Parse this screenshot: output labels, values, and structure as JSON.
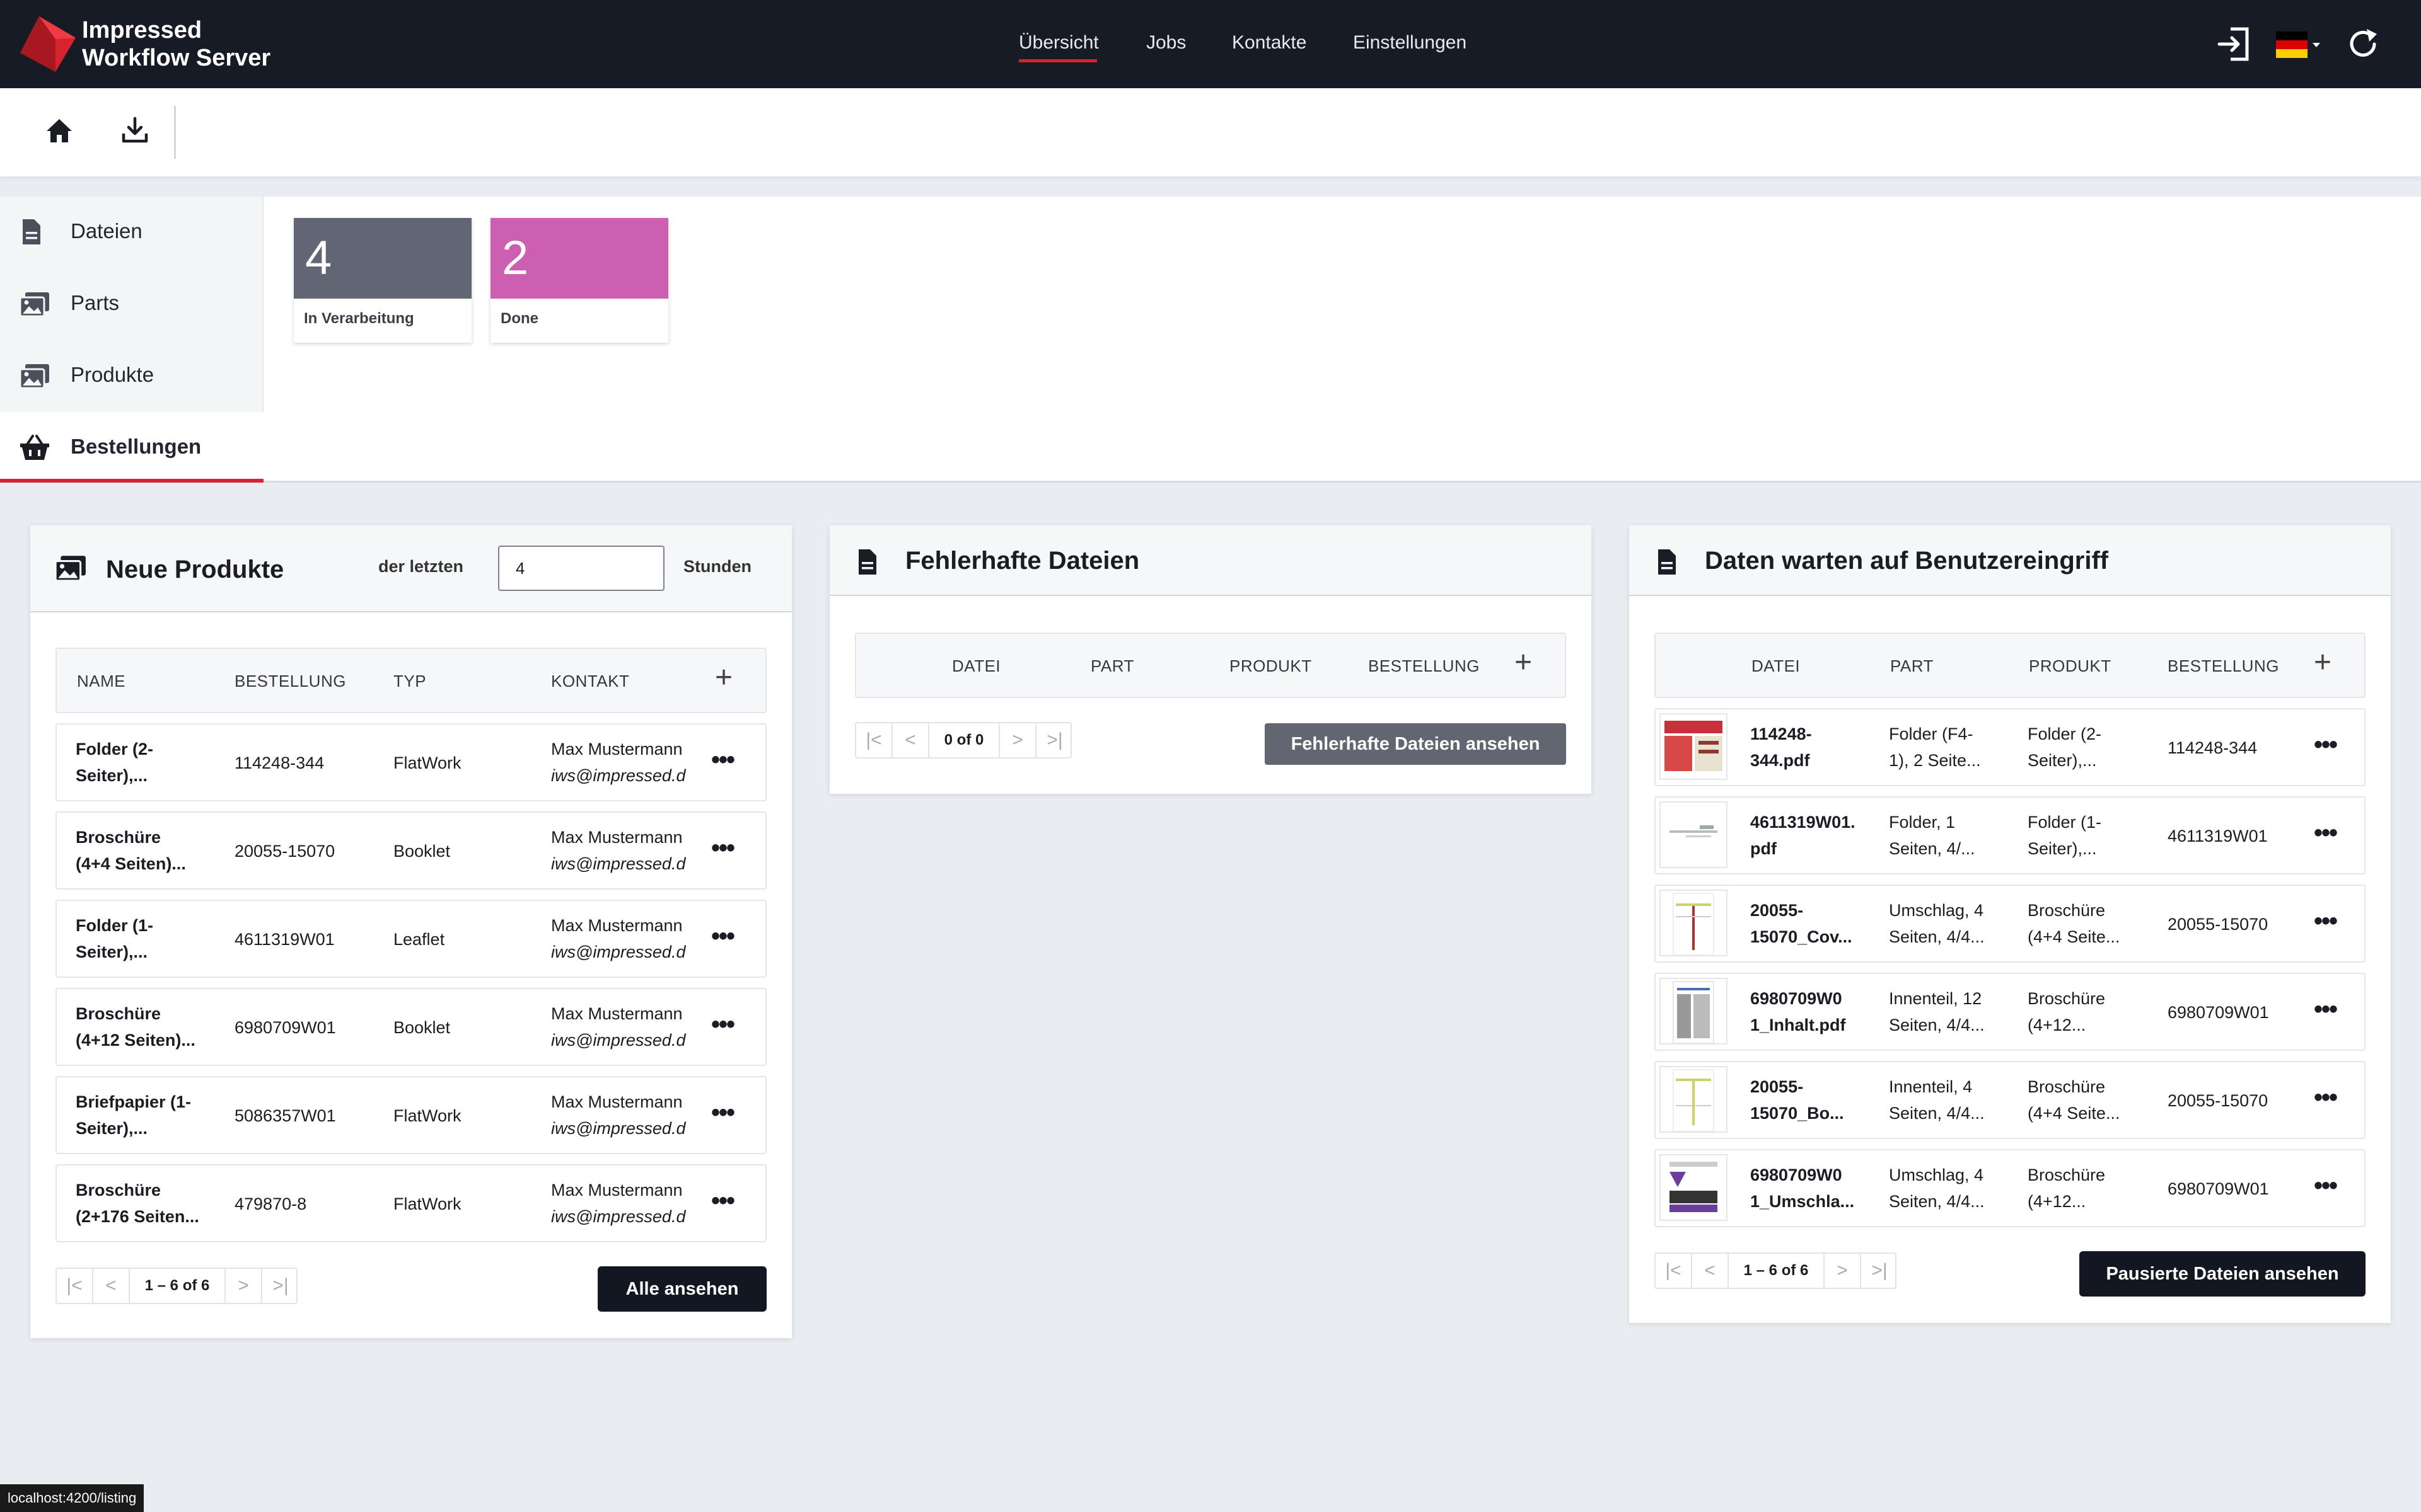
{
  "brand": {
    "line1": "Impressed",
    "line2": "Workflow Server"
  },
  "nav": [
    {
      "label": "Übersicht",
      "active": true
    },
    {
      "label": "Jobs"
    },
    {
      "label": "Kontakte"
    },
    {
      "label": "Einstellungen"
    }
  ],
  "top_icons": [
    "sign-in-icon",
    "german-flag-icon",
    "refresh-icon"
  ],
  "toolbar": {
    "icons": [
      "home-icon",
      "download-icon"
    ]
  },
  "sidebar": {
    "items": [
      {
        "label": "Dateien",
        "icon": "file-icon"
      },
      {
        "label": "Parts",
        "icon": "images-icon"
      },
      {
        "label": "Produkte",
        "icon": "images-icon"
      },
      {
        "label": "Bestellungen",
        "icon": "basket-icon",
        "active": true
      }
    ]
  },
  "stats": [
    {
      "value": "4",
      "label": "In Verarbeitung",
      "color": "#626574"
    },
    {
      "value": "2",
      "label": "Done",
      "color": "#cd5fb0"
    }
  ],
  "new_products": {
    "title": "Neue Produkte",
    "filter_prefix": "der letzten",
    "hours_value": "4",
    "filter_suffix": "Stunden",
    "columns": [
      "NAME",
      "BESTELLUNG",
      "TYP",
      "KONTAKT"
    ],
    "rows": [
      {
        "name1": "Folder (2-",
        "name2": "Seiter),...",
        "order": "114248-344",
        "type": "FlatWork",
        "contact": "Max Mustermann",
        "email": "iws@impressed.d"
      },
      {
        "name1": "Broschüre",
        "name2": "(4+4 Seiten)...",
        "order": "20055-15070",
        "type": "Booklet",
        "contact": "Max Mustermann",
        "email": "iws@impressed.d"
      },
      {
        "name1": "Folder (1-",
        "name2": "Seiter),...",
        "order": "4611319W01",
        "type": "Leaflet",
        "contact": "Max Mustermann",
        "email": "iws@impressed.d"
      },
      {
        "name1": "Broschüre",
        "name2": "(4+12 Seiten)...",
        "order": "6980709W01",
        "type": "Booklet",
        "contact": "Max Mustermann",
        "email": "iws@impressed.d"
      },
      {
        "name1": "Briefpapier (1-",
        "name2": "Seiter),...",
        "order": "5086357W01",
        "type": "FlatWork",
        "contact": "Max Mustermann",
        "email": "iws@impressed.d"
      },
      {
        "name1": "Broschüre",
        "name2": "(2+176 Seiten...",
        "order": "479870-8",
        "type": "FlatWork",
        "contact": "Max Mustermann",
        "email": "iws@impressed.d"
      }
    ],
    "pager": "1 – 6 of 6",
    "button": "Alle ansehen"
  },
  "faulty_files": {
    "title": "Fehlerhafte Dateien",
    "columns": [
      "DATEI",
      "PART",
      "PRODUKT",
      "BESTELLUNG"
    ],
    "pager": "0 of 0",
    "button": "Fehlerhafte Dateien ansehen"
  },
  "waiting_files": {
    "title": "Daten warten auf Benutzereingriff",
    "columns": [
      "DATEI",
      "PART",
      "PRODUKT",
      "BESTELLUNG"
    ],
    "rows": [
      {
        "file1": "114248-",
        "file2": "344.pdf",
        "part1": "Folder (F4-",
        "part2": "1), 2 Seite...",
        "prod1": "Folder (2-",
        "prod2": "Seiter),...",
        "order": "114248-344"
      },
      {
        "file1": "4611319W01.",
        "file2": "pdf",
        "part1": "Folder, 1",
        "part2": "Seiten, 4/...",
        "prod1": "Folder (1-",
        "prod2": "Seiter),...",
        "order": "4611319W01"
      },
      {
        "file1": "20055-",
        "file2": "15070_Cov...",
        "part1": "Umschlag, 4",
        "part2": "Seiten, 4/4...",
        "prod1": "Broschüre",
        "prod2": "(4+4 Seite...",
        "order": "20055-15070"
      },
      {
        "file1": "6980709W0",
        "file2": "1_Inhalt.pdf",
        "part1": "Innenteil, 12",
        "part2": "Seiten, 4/4...",
        "prod1": "Broschüre",
        "prod2": "(4+12...",
        "order": "6980709W01"
      },
      {
        "file1": "20055-",
        "file2": "15070_Bo...",
        "part1": "Innenteil, 4",
        "part2": "Seiten, 4/4...",
        "prod1": "Broschüre",
        "prod2": "(4+4 Seite...",
        "order": "20055-15070"
      },
      {
        "file1": "6980709W0",
        "file2": "1_Umschla...",
        "part1": "Umschlag, 4",
        "part2": "Seiten, 4/4...",
        "prod1": "Broschüre",
        "prod2": "(4+12...",
        "order": "6980709W01"
      }
    ],
    "pager": "1 – 6 of 6",
    "button": "Pausierte Dateien ansehen"
  },
  "status_url": "localhost:4200/listing"
}
